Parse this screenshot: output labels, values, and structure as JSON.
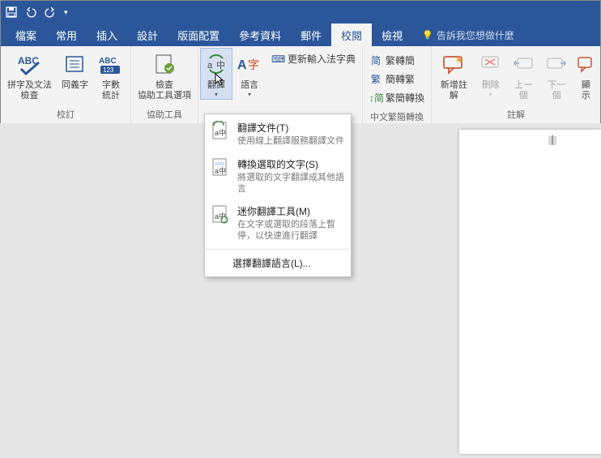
{
  "titlebar": {
    "save": "save",
    "undo": "undo",
    "redo": "redo"
  },
  "tabs": {
    "file": "檔案",
    "home": "常用",
    "insert": "插入",
    "design": "設計",
    "layout": "版面配置",
    "references": "參考資料",
    "mailings": "郵件",
    "review": "校閱",
    "view": "檢視",
    "tellme": "告訴我您想做什麼"
  },
  "ribbon": {
    "proofing": {
      "spelling": "拼字及文法\n檢查",
      "thesaurus": "同義字",
      "wordcount": "字數\n統計",
      "label": "校訂"
    },
    "accessibility": {
      "check": "檢查\n協助工具選項",
      "label": "協助工具"
    },
    "language": {
      "translate": "翻譯",
      "language": "語言",
      "update_ime": "更新輸入法字典"
    },
    "chinese": {
      "sc2tc": "繁轉簡",
      "tc2sc": "簡轉繁",
      "sc_tc": "繁簡轉換",
      "label": "中文繁簡轉換"
    },
    "comments": {
      "new": "新增註解",
      "delete": "刪除",
      "prev": "上一個",
      "next": "下一個",
      "show": "顯示",
      "label": "註解"
    }
  },
  "dropdown": {
    "item1": {
      "title": "翻譯文件(T)",
      "desc": "使用線上翻譯服務翻譯文件"
    },
    "item2": {
      "title": "轉換選取的文字(S)",
      "desc": "將選取的文字翻譯成其他語言"
    },
    "item3": {
      "title": "迷你翻譯工具(M)",
      "desc": "在文字或選取的段落上暫停，以快速進行翻譯"
    },
    "footer": "選擇翻譯語言(L)..."
  }
}
